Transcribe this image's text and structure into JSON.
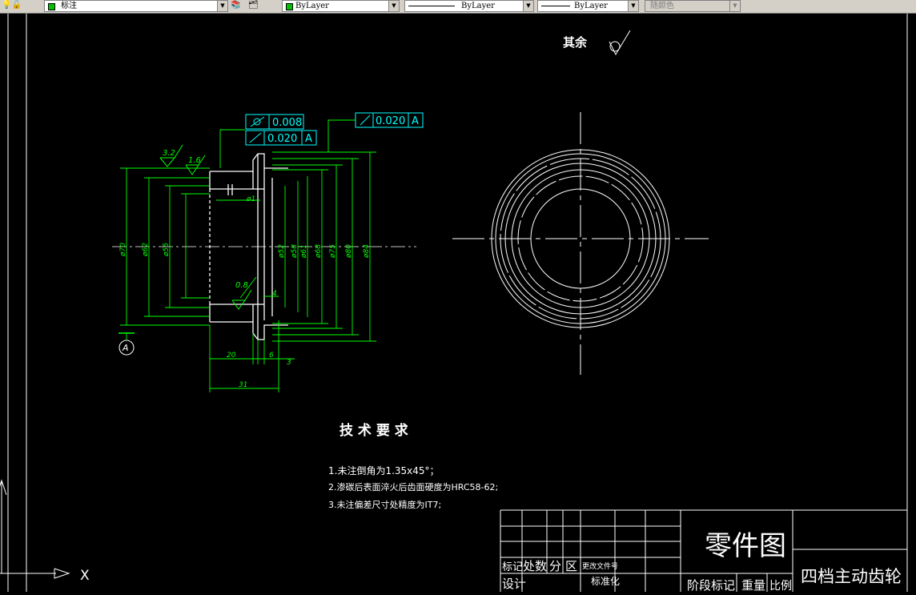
{
  "toolbar": {
    "layer_name": "标注",
    "color_label": "ByLayer",
    "linetype_label": "ByLayer",
    "lineweight_label": "ByLayer",
    "plotstyle_label": "随颜色"
  },
  "drawing": {
    "surface_note": "其余",
    "gdt1_value": "0.008",
    "gdt2_value": "0.020",
    "gdt2_datum": "A",
    "gdt3_value": "0.020",
    "gdt3_datum": "A",
    "datum_label": "A",
    "rough_32": "3.2",
    "rough_16": "1.6",
    "rough_08": "0.8",
    "dim_phi1": "ø1",
    "dim_70": "ø70",
    "dim_62": "ø62",
    "dim_55": "ø55",
    "dim_52": "ø52",
    "dim_58": "ø58",
    "dim_61": "ø61",
    "dim_68": "ø68",
    "dim_75": "ø75",
    "dim_80": "ø80",
    "dim_84": "ø84",
    "dim_4": "4",
    "dim_20": "20",
    "dim_6": "6",
    "dim_3": "3",
    "dim_31": "31"
  },
  "tech": {
    "title": "技 术 要 求",
    "items": [
      "1.未注倒角为1.35x45°；",
      "2.渗碳后表面淬火后齿面硬度为HRC58-62;",
      "3.未注偏差尺寸处精度为IT7;"
    ]
  },
  "title_block": {
    "part_type": "零件图",
    "part_name": "四档主动齿轮",
    "hdr_mark": "标记",
    "hdr_count": "处数",
    "hdr_zone": "分",
    "hdr_area": "区",
    "hdr_doc": "更改文件号",
    "hdr_design": "设计",
    "hdr_standard": "标准化",
    "hdr_stage": "阶段标记",
    "hdr_weight": "重量",
    "hdr_scale": "比例"
  },
  "ucs": {
    "x_label": "X"
  }
}
